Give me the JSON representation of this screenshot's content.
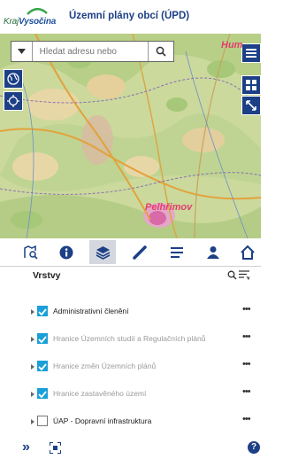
{
  "header": {
    "logo_prefix": "Kraj",
    "logo_name": "Vysočina",
    "title": "Územní plány obcí (ÚPD)"
  },
  "search": {
    "placeholder": "Hledat adresu nebo"
  },
  "map": {
    "labels": [
      {
        "text": "Pelhřimov"
      },
      {
        "text": "Hum"
      }
    ]
  },
  "toolbar": {
    "items": [
      {
        "icon": "search-map-icon"
      },
      {
        "icon": "info-icon"
      },
      {
        "icon": "layers-icon",
        "active": true
      },
      {
        "icon": "ruler-icon"
      },
      {
        "icon": "list-icon"
      },
      {
        "icon": "user-icon"
      },
      {
        "icon": "home-icon"
      }
    ]
  },
  "panel": {
    "title": "Vrstvy",
    "layers": [
      {
        "label": "Administrativní členění",
        "checked": true,
        "active": true,
        "more": "•••"
      },
      {
        "label": "Hranice Územních studií a Regulačních plánů",
        "checked": true,
        "active": false,
        "more": "•••"
      },
      {
        "label": "Hranice změn Územních plánů",
        "checked": true,
        "active": false,
        "more": "•••"
      },
      {
        "label": "Hranice zastavěného území",
        "checked": true,
        "active": false,
        "more": "•••"
      },
      {
        "label": "ÚAP - Dopravní infrastruktura",
        "checked": false,
        "active": true,
        "more": "•••"
      }
    ]
  },
  "footer": {
    "expand_symbol": "»",
    "help_symbol": "?"
  },
  "colors": {
    "brand_blue": "#1c3f86",
    "checkbox_blue": "#1aa0d8",
    "map_label": "#e23d6e"
  }
}
